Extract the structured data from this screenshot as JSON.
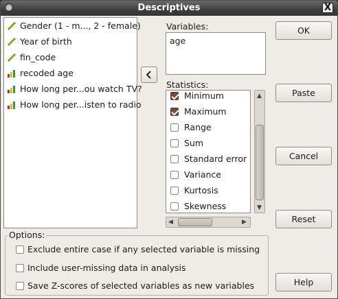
{
  "window": {
    "title": "Descriptives",
    "close_glyph": "X"
  },
  "variables_list": [
    {
      "label": "Gender (1 - m..., 2 - female)",
      "icon": "scale-ruler-icon"
    },
    {
      "label": "Year of birth",
      "icon": "scale-ruler-icon"
    },
    {
      "label": "fin_code",
      "icon": "scale-ruler-icon"
    },
    {
      "label": "recoded age",
      "icon": "ordinal-bars-icon"
    },
    {
      "label": "How long per...ou watch TV?",
      "icon": "ordinal-bars-icon"
    },
    {
      "label": "How long per...isten to radio",
      "icon": "ordinal-bars-icon"
    }
  ],
  "variables_panel": {
    "label": "Variables:",
    "items": [
      "age"
    ]
  },
  "statistics_panel": {
    "label": "Statistics:",
    "items": [
      {
        "label": "Minimum",
        "checked": true
      },
      {
        "label": "Maximum",
        "checked": true
      },
      {
        "label": "Range",
        "checked": false
      },
      {
        "label": "Sum",
        "checked": false
      },
      {
        "label": "Standard error",
        "checked": false
      },
      {
        "label": "Variance",
        "checked": false
      },
      {
        "label": "Kurtosis",
        "checked": false
      },
      {
        "label": "Skewness",
        "checked": false
      }
    ]
  },
  "buttons": {
    "ok": "OK",
    "paste": "Paste",
    "cancel": "Cancel",
    "reset": "Reset",
    "help": "Help"
  },
  "options": {
    "label": "Options:",
    "items": [
      {
        "label": "Exclude entire case if any selected variable is missing",
        "checked": false
      },
      {
        "label": "Include user-missing data in analysis",
        "checked": false
      },
      {
        "label": "Save Z-scores of selected variables as new variables",
        "checked": false
      }
    ]
  }
}
